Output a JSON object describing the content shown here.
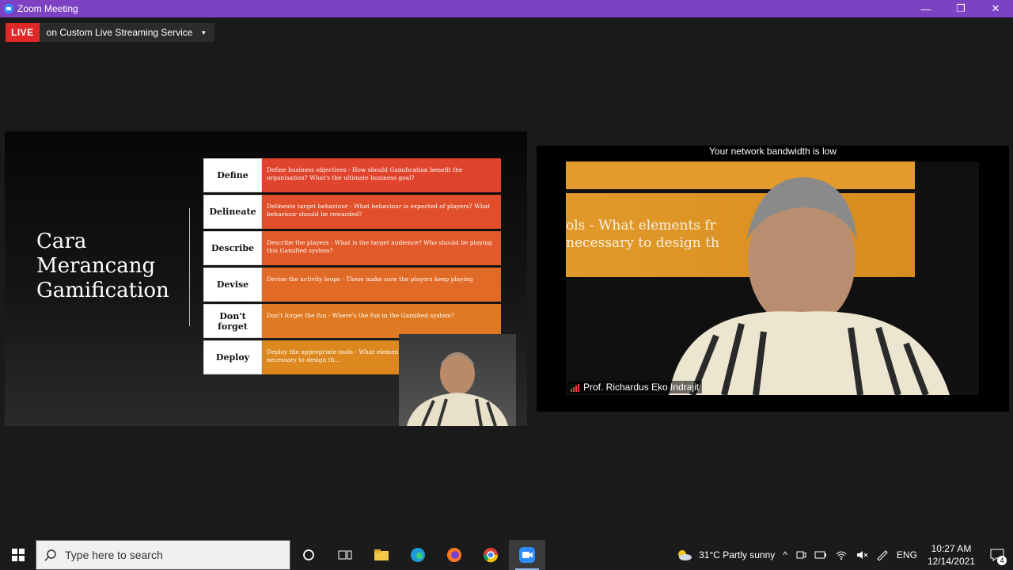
{
  "window": {
    "title": "Zoom Meeting",
    "minimize": "—",
    "maximize": "❐",
    "close": "✕"
  },
  "live": {
    "badge": "LIVE",
    "service": "on Custom Live Streaming Service",
    "caret": "▼"
  },
  "slide": {
    "title": "Cara Merancang Gamification",
    "steps": [
      {
        "name": "Define",
        "desc": "Define business objectives - How should Gamification benefit the organisation? What's the ultimate business goal?",
        "color": "#e0442c"
      },
      {
        "name": "Delineate",
        "desc": "Delineate target behaviour - What behaviour is expected of players? What behaviour should be rewarded?",
        "color": "#e04f2a"
      },
      {
        "name": "Describe",
        "desc": "Describe the players - What is the target audience? Who should be playing this Gamified system?",
        "color": "#e2592a"
      },
      {
        "name": "Devise",
        "desc": "Devise the activity loops - These make sure the players keep playing",
        "color": "#e16a26"
      },
      {
        "name": "Don't forget",
        "desc": "Don't forget the fun - Where's the fun in the Gamified system?",
        "color": "#df7a22"
      },
      {
        "name": "Deploy",
        "desc": "Deploy the appropriate tools - What elements fr... Gamification toolbox are necessary to design th...",
        "color": "#dd881e"
      }
    ]
  },
  "video": {
    "bandwidth_message": "Your network bandwidth is low",
    "banner_text_1": "ols - What elements fr",
    "banner_text_2": "necessary to design th",
    "participant": "Prof. Richardus Eko Indrajit"
  },
  "taskbar": {
    "search_placeholder": "Type here to search",
    "weather": "31°C  Partly sunny",
    "lang": "ENG",
    "time": "10:27 AM",
    "date": "12/14/2021",
    "notifications": "4"
  }
}
